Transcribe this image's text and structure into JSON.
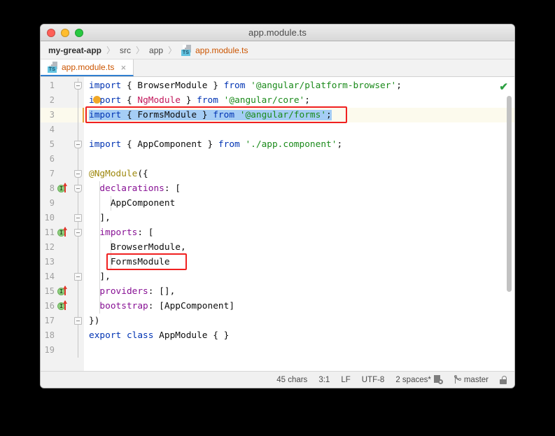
{
  "window": {
    "title": "app.module.ts",
    "traffic_lights": [
      {
        "name": "close",
        "color": "#ff5f57"
      },
      {
        "name": "minimize",
        "color": "#ffbd2e"
      },
      {
        "name": "zoom",
        "color": "#28c840"
      }
    ]
  },
  "breadcrumb": {
    "items": [
      {
        "label": "my-great-app",
        "kind": "root"
      },
      {
        "label": "src",
        "kind": "dir"
      },
      {
        "label": "app",
        "kind": "dir"
      },
      {
        "label": "app.module.ts",
        "kind": "file",
        "icon": "typescript-file-icon",
        "badge": "TS"
      }
    ],
    "separator": "〉"
  },
  "tabs": [
    {
      "label": "app.module.ts",
      "icon": "typescript-file-icon",
      "badge": "TS",
      "close": "×",
      "active": true
    }
  ],
  "editor": {
    "inspection_status_icon": "green-checkmark-icon",
    "inspection_status_glyph": "✔",
    "intention_bulb_line": 2,
    "lines": [
      {
        "n": "1",
        "segments": [
          {
            "t": "import ",
            "c": "kw"
          },
          {
            "t": "{ BrowserModule } ",
            "c": "pln"
          },
          {
            "t": "from ",
            "c": "kw"
          },
          {
            "t": "'@angular/platform-browser'",
            "c": "str"
          },
          {
            "t": ";",
            "c": "pln"
          }
        ]
      },
      {
        "n": "2",
        "segments": [
          {
            "t": "import ",
            "c": "kw"
          },
          {
            "t": "{ ",
            "c": "pln"
          },
          {
            "t": "NgModule",
            "c": "cls"
          },
          {
            "t": " } ",
            "c": "pln"
          },
          {
            "t": "from ",
            "c": "kw"
          },
          {
            "t": "'@angular/core'",
            "c": "str"
          },
          {
            "t": ";",
            "c": "pln"
          }
        ]
      },
      {
        "n": "3",
        "segments": [
          {
            "t": "import ",
            "c": "kw"
          },
          {
            "t": "{ FormsModule } ",
            "c": "pln"
          },
          {
            "t": "from ",
            "c": "kw"
          },
          {
            "t": "'@angular/forms'",
            "c": "str"
          },
          {
            "t": ";",
            "c": "pln"
          }
        ]
      },
      {
        "n": "4",
        "segments": []
      },
      {
        "n": "5",
        "segments": [
          {
            "t": "import ",
            "c": "kw"
          },
          {
            "t": "{ AppComponent } ",
            "c": "pln"
          },
          {
            "t": "from ",
            "c": "kw"
          },
          {
            "t": "'./app.component'",
            "c": "str"
          },
          {
            "t": ";",
            "c": "pln"
          }
        ]
      },
      {
        "n": "6",
        "segments": []
      },
      {
        "n": "7",
        "segments": [
          {
            "t": "@NgModule",
            "c": "deco"
          },
          {
            "t": "({",
            "c": "pln"
          }
        ]
      },
      {
        "n": "8",
        "segments": [
          {
            "t": "  ",
            "c": "pln"
          },
          {
            "t": "declarations",
            "c": "prop"
          },
          {
            "t": ": [",
            "c": "pln"
          }
        ]
      },
      {
        "n": "9",
        "segments": [
          {
            "t": "    AppComponent",
            "c": "pln"
          }
        ]
      },
      {
        "n": "10",
        "segments": [
          {
            "t": "  ],",
            "c": "pln"
          }
        ]
      },
      {
        "n": "11",
        "segments": [
          {
            "t": "  ",
            "c": "pln"
          },
          {
            "t": "imports",
            "c": "prop"
          },
          {
            "t": ": [",
            "c": "pln"
          }
        ]
      },
      {
        "n": "12",
        "segments": [
          {
            "t": "    BrowserModule,",
            "c": "pln"
          }
        ]
      },
      {
        "n": "13",
        "segments": [
          {
            "t": "    FormsModule",
            "c": "pln"
          }
        ]
      },
      {
        "n": "14",
        "segments": [
          {
            "t": "  ],",
            "c": "pln"
          }
        ]
      },
      {
        "n": "15",
        "segments": [
          {
            "t": "  ",
            "c": "pln"
          },
          {
            "t": "providers",
            "c": "prop"
          },
          {
            "t": ": [],",
            "c": "pln"
          }
        ]
      },
      {
        "n": "16",
        "segments": [
          {
            "t": "  ",
            "c": "pln"
          },
          {
            "t": "bootstrap",
            "c": "prop"
          },
          {
            "t": ": [AppComponent]",
            "c": "pln"
          }
        ]
      },
      {
        "n": "17",
        "segments": [
          {
            "t": "})",
            "c": "pln"
          }
        ]
      },
      {
        "n": "18",
        "segments": [
          {
            "t": "export ",
            "c": "kw"
          },
          {
            "t": "class ",
            "c": "kw"
          },
          {
            "t": "AppModule { }",
            "c": "pln"
          }
        ]
      },
      {
        "n": "19",
        "segments": []
      }
    ],
    "highlighted_line": 3,
    "selection": {
      "line": 3,
      "text": "import { FormsModule } from '@angular/forms';"
    },
    "gutter_markers": [
      {
        "line": 8,
        "icon": "implementation-marker-icon"
      },
      {
        "line": 11,
        "icon": "implementation-marker-icon"
      },
      {
        "line": 15,
        "icon": "implementation-marker-icon"
      },
      {
        "line": 16,
        "icon": "implementation-marker-icon"
      }
    ],
    "fold_markers": [
      1,
      5,
      7,
      8,
      10,
      11,
      14,
      17
    ],
    "change_bar_line": 3,
    "annotations": [
      {
        "name": "import-statement-highlight-box",
        "line": 3
      },
      {
        "name": "forms-module-entry-highlight-box",
        "line": 13
      }
    ]
  },
  "statusbar": {
    "chars": "45 chars",
    "caret": "3:1",
    "line_separator": "LF",
    "encoding": "UTF-8",
    "indent": "2 spaces*",
    "indent_icon": "indent-settings-icon",
    "branch_icon": "git-branch-icon",
    "branch": "master",
    "lock_icon": "read-only-lock-icon"
  }
}
